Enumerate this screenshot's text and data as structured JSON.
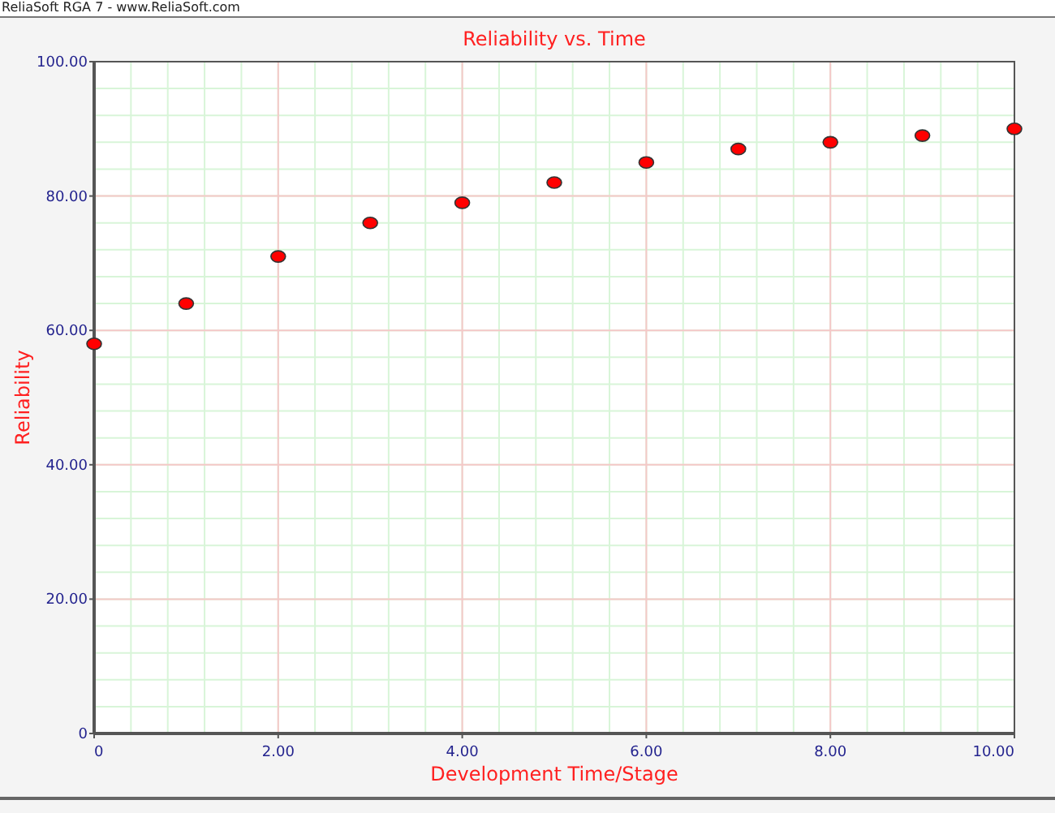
{
  "window": {
    "title": "ReliaSoft RGA 7 - www.ReliaSoft.com"
  },
  "plot": {
    "chart_data": {
      "type": "scatter",
      "title": "Reliability vs. Time",
      "xlabel": "Development Time/Stage",
      "ylabel": "Reliability",
      "x": [
        0,
        1,
        2,
        3,
        4,
        5,
        6,
        7,
        8,
        9,
        10
      ],
      "grid": true,
      "series": [
        {
          "color": "#ff0000",
          "values": [
            58,
            64,
            71,
            76,
            79,
            82,
            85,
            87,
            88,
            89,
            90
          ]
        }
      ],
      "xlim": [
        0,
        10
      ],
      "ylim": [
        0,
        100
      ],
      "xticks": [
        {
          "value": 0,
          "label": "0"
        },
        {
          "value": 2,
          "label": "2.00"
        },
        {
          "value": 4,
          "label": "4.00"
        },
        {
          "value": 6,
          "label": "6.00"
        },
        {
          "value": 8,
          "label": "8.00"
        },
        {
          "value": 10,
          "label": "10.00"
        }
      ],
      "yticks": [
        {
          "value": 0,
          "label": "0"
        },
        {
          "value": 20,
          "label": "20.00"
        },
        {
          "value": 40,
          "label": "40.00"
        },
        {
          "value": 60,
          "label": "60.00"
        },
        {
          "value": 80,
          "label": "80.00"
        },
        {
          "value": 100,
          "label": "100.00"
        }
      ]
    }
  }
}
